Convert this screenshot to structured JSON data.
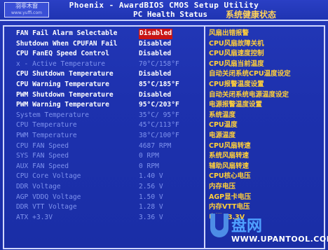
{
  "header": {
    "logo_main": "羽非木窗",
    "logo_sub": "www.yuffi.com",
    "title": "Phoenix - AwardBIOS CMOS Setup Utility",
    "subtitle": "PC Health Status",
    "subtitle_cn": "系统健康状态"
  },
  "rows": [
    {
      "label": "FAN Fail Alarm Selectable",
      "value": "Disabled",
      "cn": "风扇出错报警"
    },
    {
      "label": "Shutdown When CPUFAN Fail",
      "value": "Disabled",
      "cn": "CPU风扇故障关机"
    },
    {
      "label": "CPU FanEQ Speed Control",
      "value": "Disabled",
      "cn": "CPU风扇速度控制"
    },
    {
      "label": "x - Active Temperature",
      "value": "70°C/158°F",
      "cn": "CPU风扇当前温度"
    },
    {
      "label": "CPU Shutdown Temperature",
      "value": "Disabled",
      "cn": "自动关闭系统CPU温度设定"
    },
    {
      "label": "CPU Warning Temperature",
      "value": "85°C/185°F",
      "cn": "CPU报警温度设置"
    },
    {
      "label": "PWM Shutdown Temperature",
      "value": "Disabled",
      "cn": "自动关闭系统电源温度设定"
    },
    {
      "label": "PWM Warning Temperature",
      "value": "95°C/203°F",
      "cn": "电源报警温度设置"
    },
    {
      "label": "System Temperature",
      "value": "35°C/ 95°F",
      "cn": "系统温度"
    },
    {
      "label": "CPU Temperature",
      "value": "45°C/113°F",
      "cn": "CPU温度"
    },
    {
      "label": "PWM Temperature",
      "value": "38°C/100°F",
      "cn": "电源温度"
    },
    {
      "label": "CPU FAN Speed",
      "value": "4687 RPM",
      "cn": "CPU风扇转速"
    },
    {
      "label": "SYS FAN Speed",
      "value": "0 RPM",
      "cn": "系统风扇转速"
    },
    {
      "label": "AUX FAN Speed",
      "value": "0 RPM",
      "cn": "辅助风扇转速"
    },
    {
      "label": "CPU Core Voltage",
      "value": "1.40 V",
      "cn": "CPU核心电压"
    },
    {
      "label": "DDR Voltage",
      "value": "2.56 V",
      "cn": "内存电压"
    },
    {
      "label": "AGP VDDQ Voltage",
      "value": "1.50 V",
      "cn": "AGP显卡电压"
    },
    {
      "label": "DDR VTT Voltage",
      "value": "1.28 V",
      "cn": "内存VTT电压"
    },
    {
      "label": "ATX +3.3V",
      "value": "3.36 V",
      "cn": "电源+3.3V"
    }
  ],
  "watermark": {
    "logo_cn": "盘网",
    "url": "WWW.UPANTOOL.COM"
  },
  "colors": {
    "bg": "#1d31ae",
    "highlight": "#ffffff",
    "dim": "#7f93ee",
    "selected": "#c81414",
    "cn_text": "#ffcf3a"
  }
}
